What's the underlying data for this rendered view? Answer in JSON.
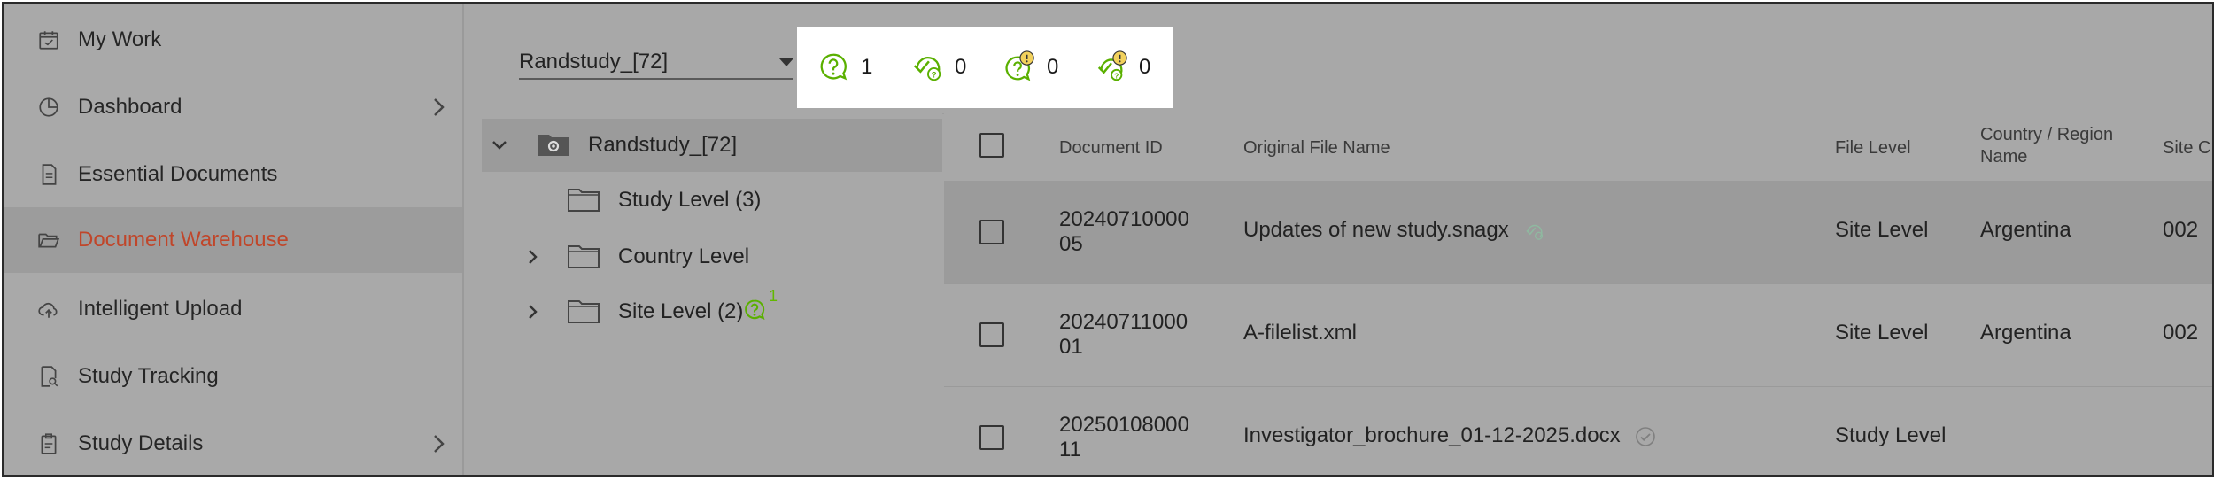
{
  "sidebar": {
    "items": [
      {
        "label": "My Work",
        "icon": "calendar-icon",
        "has_chevron": false,
        "active": false
      },
      {
        "label": "Dashboard",
        "icon": "pie-chart-icon",
        "has_chevron": true,
        "active": false
      },
      {
        "label": "Essential Documents",
        "icon": "document-icon",
        "has_chevron": false,
        "active": false
      },
      {
        "label": "Document Warehouse",
        "icon": "open-folder-icon",
        "has_chevron": false,
        "active": true
      },
      {
        "label": "Intelligent Upload",
        "icon": "cloud-upload-icon",
        "has_chevron": false,
        "active": false
      },
      {
        "label": "Study Tracking",
        "icon": "doc-search-icon",
        "has_chevron": false,
        "active": false
      },
      {
        "label": "Study Details",
        "icon": "clipboard-icon",
        "has_chevron": true,
        "active": false
      }
    ]
  },
  "study_select": {
    "value": "Randstudy_[72]"
  },
  "stats": [
    {
      "icon": "question-bubble-icon",
      "count": "1"
    },
    {
      "icon": "check-question-bubble-icon",
      "count": "0"
    },
    {
      "icon": "question-bubble-alert-icon",
      "count": "0"
    },
    {
      "icon": "check-question-bubble-alert-icon",
      "count": "0"
    }
  ],
  "tree": {
    "root": {
      "label": "Randstudy_[72]"
    },
    "children": [
      {
        "label": "Study Level (3)",
        "expandable": false
      },
      {
        "label": "Country Level",
        "expandable": true
      },
      {
        "label": "Site Level (2)",
        "expandable": true,
        "badge_count": "1"
      }
    ]
  },
  "table": {
    "headers": {
      "document_id": "Document ID",
      "file_name": "Original File Name",
      "file_level": "File Level",
      "country": "Country / Region Name",
      "site": "Site C"
    },
    "rows": [
      {
        "id_line1": "20240710000",
        "id_line2": "05",
        "file_name": "Updates of new study.snagx",
        "file_level": "Site Level",
        "country": "Argentina",
        "site": "002",
        "status_icon": "check-question-icon"
      },
      {
        "id_line1": "20240711000",
        "id_line2": "01",
        "file_name": "A-filelist.xml",
        "file_level": "Site Level",
        "country": "Argentina",
        "site": "002",
        "status_icon": ""
      },
      {
        "id_line1": "20250108000",
        "id_line2": "11",
        "file_name": "Investigator_brochure_01-12-2025.docx",
        "file_level": "Study Level",
        "country": "",
        "site": "",
        "status_icon": "check-circle-icon"
      }
    ]
  },
  "colors": {
    "active_nav": "#c0462a",
    "badge_green": "#62b800",
    "alert_yellow": "#f2d15c"
  }
}
